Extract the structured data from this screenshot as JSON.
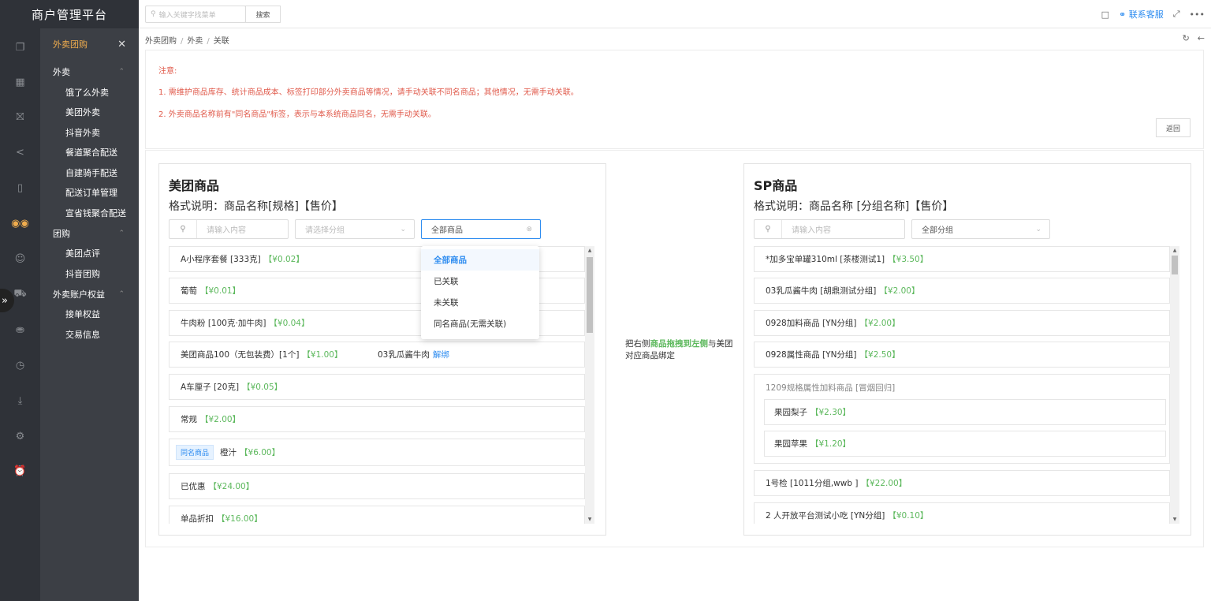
{
  "app": {
    "title": "商户管理平台"
  },
  "topbar": {
    "search_placeholder": "输入关键字找菜单",
    "search_button": "搜索",
    "service_label": "联系客服",
    "more_label": "•••"
  },
  "submenu": {
    "header": "外卖团购",
    "groups": [
      {
        "label": "外卖",
        "items": [
          "饿了么外卖",
          "美团外卖",
          "抖音外卖",
          "餐道聚合配送",
          "自建骑手配送",
          "配送订单管理",
          "宣省钱聚合配送"
        ]
      },
      {
        "label": "团购",
        "items": [
          "美团点评",
          "抖音团购"
        ]
      },
      {
        "label": "外卖账户权益",
        "items": [
          "接单权益",
          "交易信息"
        ]
      }
    ]
  },
  "breadcrumb": [
    "外卖团购",
    "外卖",
    "关联"
  ],
  "notice": {
    "title": "注意:",
    "line1": "1. 需维护商品库存、统计商品成本、标签打印部分外卖商品等情况，请手动关联不同名商品；其他情况，无需手动关联。",
    "line2": "2. 外卖商品名称前有\"同名商品\"标签，表示与本系统商品同名，无需手动关联。",
    "back_button": "返回"
  },
  "left_panel": {
    "title": "美团商品",
    "format": "格式说明：商品名称[规格]【售价】",
    "search_placeholder": "请输入内容",
    "group_placeholder": "请选择分组",
    "status_value": "全部商品",
    "items": [
      {
        "name": "A小程序套餐 [333克]",
        "price": "【¥0.02】"
      },
      {
        "name": "葡萄",
        "price": "【¥0.01】"
      },
      {
        "name": "牛肉粉 [100克·加牛肉]",
        "price": "【¥0.04】"
      },
      {
        "name": "美团商品100（无包装费）[1个]",
        "price": "【¥1.00】",
        "linked": "03乳瓜酱牛肉",
        "action": "解绑"
      },
      {
        "name": "A车厘子 [20克]",
        "price": "【¥0.05】"
      },
      {
        "name": "常规",
        "price": "【¥2.00】"
      },
      {
        "tag": "同名商品",
        "name": "橙汁",
        "price": "【¥6.00】"
      },
      {
        "name": "已优惠",
        "price": "【¥24.00】"
      },
      {
        "name": "单品折扣",
        "price": "【¥16.00】"
      }
    ]
  },
  "status_dropdown": {
    "options": [
      "全部商品",
      "已关联",
      "未关联",
      "同名商品(无需关联)"
    ],
    "selected": "全部商品"
  },
  "hint": {
    "before": "把右侧",
    "highlight": "商品拖拽到左侧",
    "after": "与美团对应商品绑定"
  },
  "right_panel": {
    "title": "SP商品",
    "format": "格式说明：商品名称 [分组名称]【售价】",
    "search_placeholder": "请输入内容",
    "group_value": "全部分组",
    "items": [
      {
        "name": "*加多宝单罐310ml [茶楼测试1]",
        "price": "【¥3.50】"
      },
      {
        "name": "03乳瓜酱牛肉 [胡鼎测试分组]",
        "price": "【¥2.00】"
      },
      {
        "name": "0928加料商品 [YN分组]",
        "price": "【¥2.00】"
      },
      {
        "name": "0928属性商品 [YN分组]",
        "price": "【¥2.50】"
      }
    ],
    "group_item": {
      "title": "1209规格属性加料商品 [冒烟回归]",
      "children": [
        {
          "name": "果园梨子",
          "price": "【¥2.30】"
        },
        {
          "name": "果园苹果",
          "price": "【¥1.20】"
        }
      ]
    },
    "items_after": [
      {
        "name": "1号检 [1011分组,wwb ]",
        "price": "【¥22.00】"
      },
      {
        "name": "2 人开放平台测试小吃 [YN分组]",
        "price": "【¥0.10】"
      }
    ]
  },
  "icons": {
    "rail": [
      "copy-icon",
      "calendar-icon",
      "bag-icon",
      "share-icon",
      "tablet-icon",
      "bike-icon",
      "user-icon",
      "truck-icon",
      "database-icon",
      "clock-icon",
      "download-icon",
      "settings-icon",
      "alarm-icon"
    ]
  }
}
